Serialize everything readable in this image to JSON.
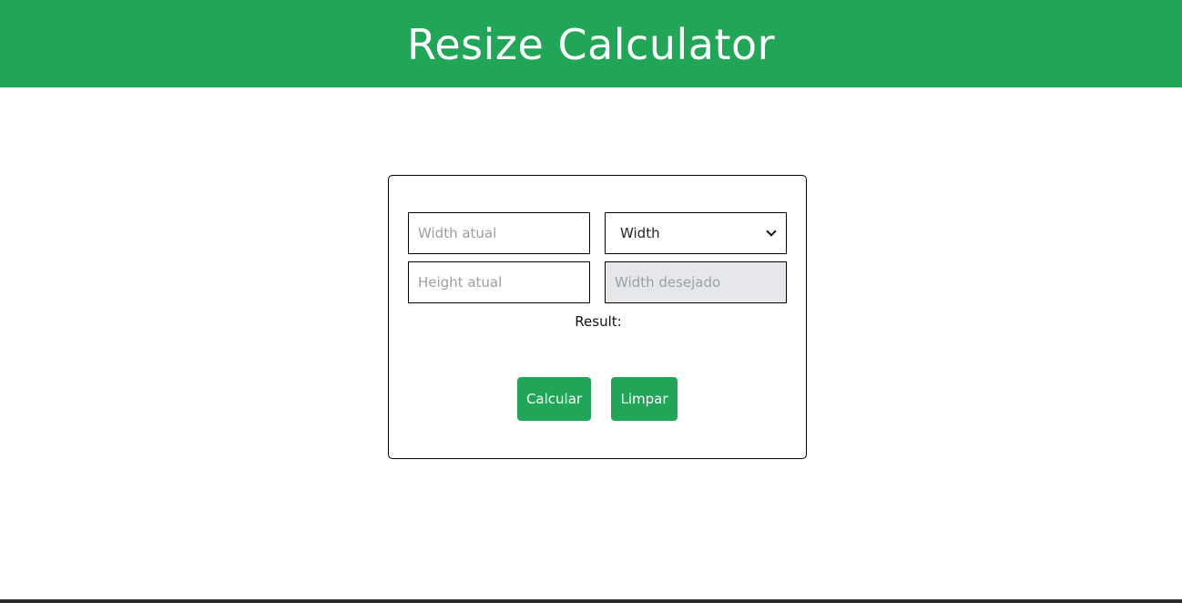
{
  "header": {
    "title": "Resize Calculator"
  },
  "form": {
    "width_atual": {
      "placeholder": "Width atual",
      "value": ""
    },
    "height_atual": {
      "placeholder": "Height atual",
      "value": ""
    },
    "dimension_select": {
      "selected": "Width",
      "icon": "chevron-down-icon"
    },
    "width_desejado": {
      "placeholder": "Width desejado",
      "value": ""
    },
    "result_label": "Result:"
  },
  "buttons": {
    "calcular_label": "Calcular",
    "limpar_label": "Limpar"
  },
  "colors": {
    "accent": "#21a556",
    "disabled_field": "#e6e7ea"
  }
}
